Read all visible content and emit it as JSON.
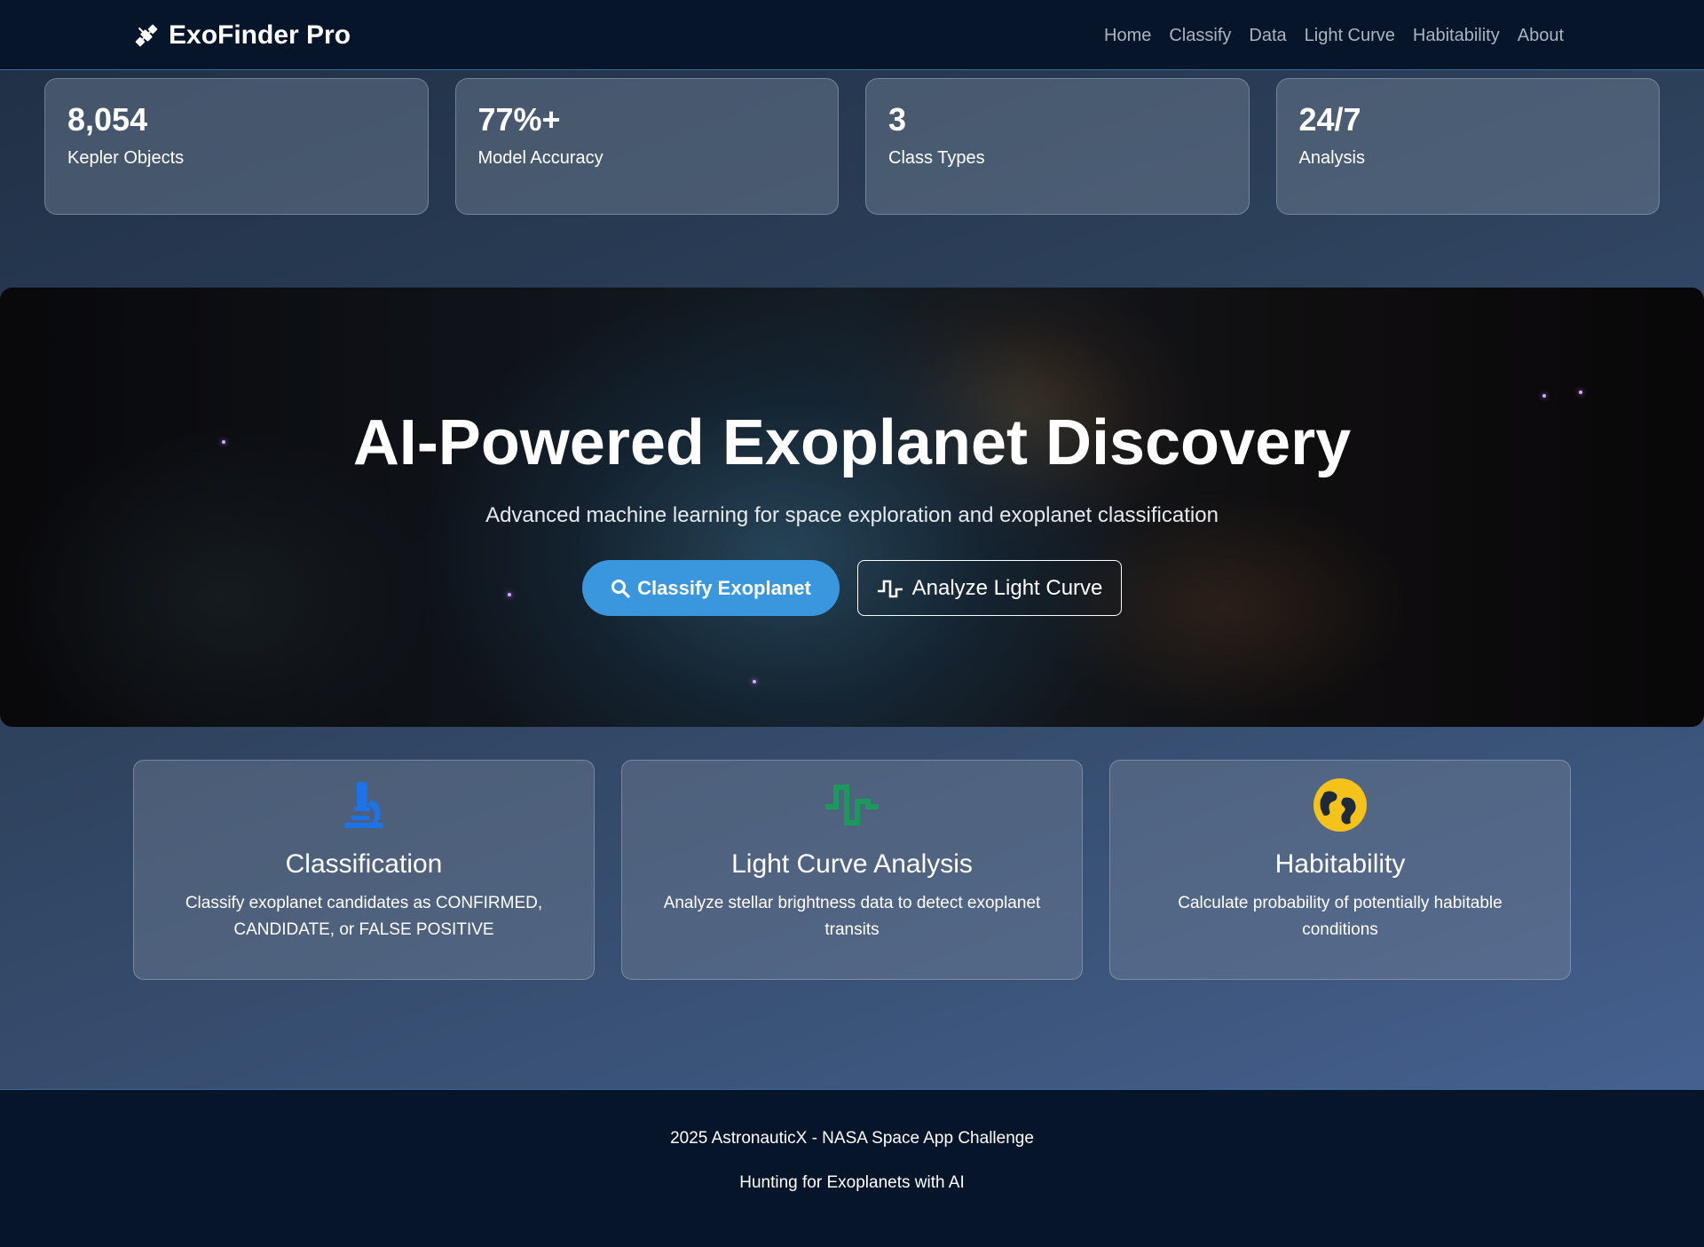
{
  "navbar": {
    "brand": "ExoFinder Pro",
    "brand_icon": "satellite-icon",
    "links": [
      "Home",
      "Classify",
      "Data",
      "Light Curve",
      "Habitability",
      "About"
    ]
  },
  "stats": [
    {
      "value": "8,054",
      "label": "Kepler Objects"
    },
    {
      "value": "77%+",
      "label": "Model Accuracy"
    },
    {
      "value": "3",
      "label": "Class Types"
    },
    {
      "value": "24/7",
      "label": "Analysis"
    }
  ],
  "hero": {
    "title": "AI-Powered Exoplanet Discovery",
    "subtitle": "Advanced machine learning for space exploration and exoplanet classification",
    "primary_button": "Classify Exoplanet",
    "secondary_button": "Analyze Light Curve"
  },
  "features": [
    {
      "icon": "microscope-icon",
      "color": "#1c74e8",
      "title": "Classification",
      "desc": "Classify exoplanet candidates as CONFIRMED, CANDIDATE, or FALSE POSITIVE"
    },
    {
      "icon": "pulse-icon",
      "color": "#1a9a5a",
      "title": "Light Curve Analysis",
      "desc": "Analyze stellar brightness data to detect exoplanet transits"
    },
    {
      "icon": "globe-icon",
      "color": "#f5c21a",
      "title": "Habitability",
      "desc": "Calculate probability of potentially habitable conditions"
    }
  ],
  "footer": {
    "line1": "2025 AstronauticX - NASA Space App Challenge",
    "line2": "Hunting for Exoplanets with AI"
  },
  "colors": {
    "navbar_bg": "#06152a",
    "primary_button": "#3a97dd",
    "accent_blue": "#1c74e8",
    "accent_green": "#1a9a5a",
    "accent_yellow": "#f5c21a"
  }
}
